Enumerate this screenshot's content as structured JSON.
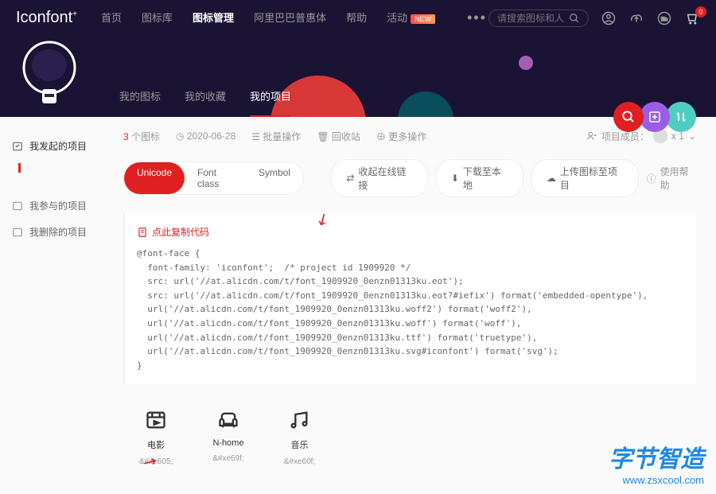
{
  "header": {
    "logo": "Iconfont",
    "nav": [
      "首页",
      "图标库",
      "图标管理",
      "阿里巴巴普惠体",
      "帮助",
      "活动"
    ],
    "new_badge": "NEW",
    "search_placeholder": "请搜索图标和人",
    "cart_count": "0"
  },
  "subnav": [
    "我的图标",
    "我的收藏",
    "我的项目"
  ],
  "sidebar": {
    "item1": "我发起的项目",
    "item2": "我参与的项目",
    "item3": "我删除的项目"
  },
  "toolbar": {
    "count": "3",
    "count_label": "个图标",
    "date": "2020-06-28",
    "batch": "批量操作",
    "recycle": "回收站",
    "more": "更多操作",
    "members_label": "项目成员：",
    "members_count": "x 1"
  },
  "tabs": {
    "unicode": "Unicode",
    "fontclass": "Font class",
    "symbol": "Symbol"
  },
  "actions": {
    "view_link": "收起在线链接",
    "download": "下载至本地",
    "upload": "上传图标至项目",
    "help": "使用帮助"
  },
  "code": {
    "copy_label": "点此复制代码",
    "content": "@font-face {\n  font-family: 'iconfont';  /* project id 1909920 */\n  src: url('//at.alicdn.com/t/font_1909920_0enzn01313ku.eot');\n  src: url('//at.alicdn.com/t/font_1909920_0enzn01313ku.eot?#iefix') format('embedded-opentype'),\n  url('//at.alicdn.com/t/font_1909920_0enzn01313ku.woff2') format('woff2'),\n  url('//at.alicdn.com/t/font_1909920_0enzn01313ku.woff') format('woff'),\n  url('//at.alicdn.com/t/font_1909920_0enzn01313ku.ttf') format('truetype'),\n  url('//at.alicdn.com/t/font_1909920_0enzn01313ku.svg#iconfont') format('svg');\n}"
  },
  "icons": [
    {
      "name": "电影",
      "code": "&#xe605;"
    },
    {
      "name": "N-home",
      "code": "&#xe69f;"
    },
    {
      "name": "音乐",
      "code": "&#xe60f;"
    }
  ],
  "watermark": {
    "brand": "字节智造",
    "url": "www.zsxcool.com"
  }
}
